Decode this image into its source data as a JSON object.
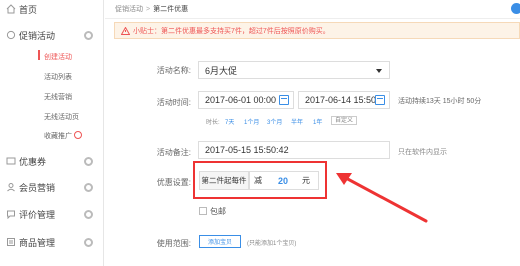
{
  "sidebar": {
    "items": [
      {
        "label": "首页",
        "icon": "home-icon"
      },
      {
        "label": "促销活动",
        "icon": "promo-icon"
      },
      {
        "label": "优惠券",
        "icon": "coupon-icon"
      },
      {
        "label": "会员营销",
        "icon": "member-icon"
      },
      {
        "label": "评价管理",
        "icon": "review-icon"
      },
      {
        "label": "商品管理",
        "icon": "goods-icon"
      }
    ],
    "sub_items": [
      {
        "label": "创建活动"
      },
      {
        "label": "活动列表"
      },
      {
        "label": "无线营销"
      },
      {
        "label": "无线活动页"
      },
      {
        "label": "收藏推广"
      }
    ]
  },
  "breadcrumb": {
    "parent": "促销活动",
    "separator": ">",
    "current": "第二件优惠"
  },
  "notice": {
    "icon": "warning-icon",
    "text": "小贴士：第二件优惠最多支持买7件，超过7件后按照原价购买。"
  },
  "form": {
    "name_label": "活动名称:",
    "name_value": "6月大促",
    "time_label": "活动时间:",
    "start_time": "2017-06-01 00:00",
    "end_time": "2017-06-14 15:50",
    "time_dash": "-",
    "duration_text": "活动持续13天 15小时 50分",
    "quick_label": "时长:",
    "quick_options": [
      "7天",
      "1个月",
      "3个月",
      "半年",
      "1年"
    ],
    "quick_custom": "自定义",
    "remark_label": "活动备注:",
    "remark_value": "2017-05-15 15:50:42",
    "remark_hint": "只在软件内显示",
    "discount_label": "优惠设置:",
    "discount_type": "第二件起每件",
    "discount_prefix": "减",
    "discount_value": "20",
    "discount_unit": "元",
    "free_shipping_label": "包邮",
    "scope_label": "使用范围:",
    "add_product_button": "添加宝贝",
    "add_product_hint": "(只能添加1个宝贝)"
  },
  "colors": {
    "accent": "#3a8ee6",
    "danger": "#e33333",
    "notice_bg": "#fdf3e7"
  }
}
